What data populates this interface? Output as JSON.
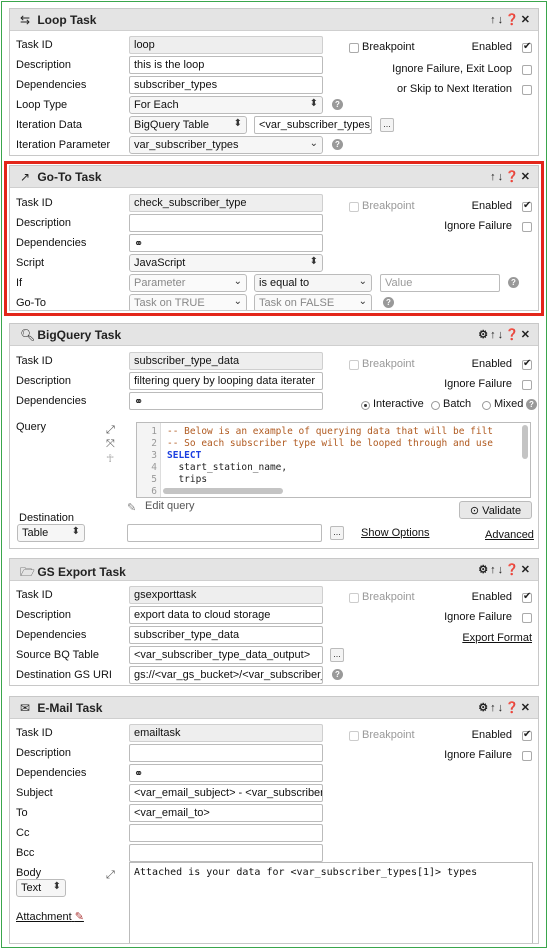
{
  "loop": {
    "title": "Loop Task",
    "task_id_label": "Task ID",
    "task_id": "loop",
    "desc_label": "Description",
    "desc": "this is the loop",
    "deps_label": "Dependencies",
    "deps": "subscriber_types",
    "loop_type_label": "Loop Type",
    "loop_type": "For Each",
    "iter_data_label": "Iteration Data",
    "iter_data": "BigQuery Table",
    "iter_data_value": "<var_subscriber_types_",
    "iter_param_label": "Iteration Parameter",
    "iter_param": "var_subscriber_types",
    "breakpoint": "Breakpoint",
    "enabled": "Enabled",
    "ignore_fail": "Ignore Failure, Exit Loop",
    "skip_next": "or Skip to Next Iteration",
    "more": "..."
  },
  "goto": {
    "title": "Go-To Task",
    "task_id_label": "Task ID",
    "task_id": "check_subscriber_type",
    "desc_label": "Description",
    "desc": "",
    "deps_label": "Dependencies",
    "script_label": "Script",
    "script": "JavaScript",
    "if_label": "If",
    "if_operand": "Parameter",
    "if_op": "is equal to",
    "if_value_placeholder": "Value",
    "goto_label": "Go-To",
    "on_true": "Task on TRUE",
    "on_false": "Task on FALSE",
    "breakpoint": "Breakpoint",
    "enabled": "Enabled",
    "ignore_fail": "Ignore Failure"
  },
  "bq": {
    "title": "BigQuery Task",
    "task_id_label": "Task ID",
    "task_id": "subscriber_type_data",
    "desc_label": "Description",
    "desc": "filtering query by looping data iterater",
    "deps_label": "Dependencies",
    "query_label": "Query",
    "code_lines": [
      {
        "n": "1",
        "t": "-- Below is an example of querying data that will be filt",
        "c": "cm"
      },
      {
        "n": "2",
        "t": "-- So each subscriber type will be looped through and use",
        "c": "cm"
      },
      {
        "n": "3",
        "t": "SELECT",
        "c": "kw"
      },
      {
        "n": "4",
        "t": "  start_station_name,",
        "c": ""
      },
      {
        "n": "5",
        "t": "  trips",
        "c": ""
      },
      {
        "n": "6",
        "t": "",
        "c": ""
      }
    ],
    "edit_query": "Edit query",
    "validate": "Validate",
    "dest_label": "Destination",
    "dest": "Table",
    "show_options": "Show Options",
    "advanced": "Advanced",
    "breakpoint": "Breakpoint",
    "enabled": "Enabled",
    "ignore_fail": "Ignore Failure",
    "interactive": "Interactive",
    "batch": "Batch",
    "mixed": "Mixed",
    "more": "..."
  },
  "gs": {
    "title": "GS Export Task",
    "task_id_label": "Task ID",
    "task_id": "gsexporttask",
    "desc_label": "Description",
    "desc": "export data to cloud storage",
    "deps_label": "Dependencies",
    "deps": "subscriber_type_data",
    "src_label": "Source BQ Table",
    "src": "<var_subscriber_type_data_output>",
    "dest_label": "Destination GS URI",
    "dest": "gs://<var_gs_bucket>/<var_subscriber_",
    "breakpoint": "Breakpoint",
    "enabled": "Enabled",
    "ignore_fail": "Ignore Failure",
    "export_format": "Export Format",
    "more": "..."
  },
  "email": {
    "title": "E-Mail Task",
    "task_id_label": "Task ID",
    "task_id": "emailtask",
    "desc_label": "Description",
    "desc": "",
    "deps_label": "Dependencies",
    "subject_label": "Subject",
    "subject": "<var_email_subject> - <var_subscriber_",
    "to_label": "To",
    "to": "<var_email_to>",
    "cc_label": "Cc",
    "bcc_label": "Bcc",
    "body_label": "Body",
    "body_type": "Text",
    "body": "Attached is your data for <var_subscriber_types[1]> types",
    "attachment": "Attachment",
    "breakpoint": "Breakpoint",
    "enabled": "Enabled",
    "ignore_fail": "Ignore Failure"
  },
  "colors": {
    "highlight": "#e3261a",
    "outline": "#3aa64c"
  }
}
